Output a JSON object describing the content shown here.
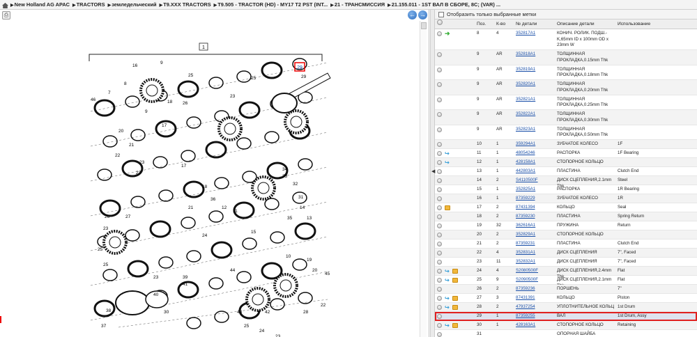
{
  "breadcrumb": {
    "items": [
      "New Holland AG APAC",
      "TRACTORS",
      "земледельческий",
      "T9.XXX TRACTORS",
      "T9.505 - TRACTOR (HD) - MY17 T2 PST (INT...",
      "21 - ТРАНСМИССИЯ",
      "21.155.011 - 1ST ВАЛ В СБОРЕ, 8C; (VAR) ..."
    ]
  },
  "filter": {
    "label": "Отобразить только выбранные метки"
  },
  "table": {
    "headers": {
      "pos": "Поз.",
      "qty": "К-во",
      "part": "№ детали",
      "desc": "Описание детали",
      "use": "Использование"
    },
    "rows": [
      {
        "pos": "8",
        "qty": "4",
        "part": "352817A1",
        "desc": "КОНИЧ. РОЛИК. ПОДШ.- K,65mm ID x 100mm OD x 23mm W",
        "use": "",
        "icons": [
          "green"
        ]
      },
      {
        "pos": "9",
        "qty": "AR",
        "part": "352818A1",
        "desc": "ТОЛЩИННАЯ ПРОКЛАДКА,0.15mm Thk",
        "use": "",
        "icons": []
      },
      {
        "pos": "9",
        "qty": "AR",
        "part": "352819A1",
        "desc": "ТОЛЩИННАЯ ПРОКЛАДКА,0.18mm Thk",
        "use": "",
        "icons": []
      },
      {
        "pos": "9",
        "qty": "AR",
        "part": "352820A1",
        "desc": "ТОЛЩИННАЯ ПРОКЛАДКА,0.20mm Thk",
        "use": "",
        "icons": []
      },
      {
        "pos": "9",
        "qty": "AR",
        "part": "352821A1",
        "desc": "ТОЛЩИННАЯ ПРОКЛАДКА,0.25mm Thk",
        "use": "",
        "icons": []
      },
      {
        "pos": "9",
        "qty": "AR",
        "part": "352822A1",
        "desc": "ТОЛЩИННАЯ ПРОКЛАДКА,0.30mm Thk",
        "use": "",
        "icons": []
      },
      {
        "pos": "9",
        "qty": "AR",
        "part": "352823A1",
        "desc": "ТОЛЩИННАЯ ПРОКЛАДКА,0.50mm Thk",
        "use": "",
        "icons": []
      },
      {
        "pos": "10",
        "qty": "1",
        "part": "359294A1",
        "desc": "ЗУБЧАТОЕ КОЛЕСО",
        "use": "1F",
        "icons": []
      },
      {
        "pos": "11",
        "qty": "1",
        "part": "48054246",
        "desc": "РАСПОРКА",
        "use": "1F Bearing",
        "icons": [
          "link"
        ]
      },
      {
        "pos": "12",
        "qty": "1",
        "part": "428158A1",
        "desc": "СТОПОРНОЕ КОЛЬЦО",
        "use": "",
        "icons": [
          "link"
        ]
      },
      {
        "pos": "13",
        "qty": "1",
        "part": "442803A1",
        "desc": "ПЛАСТИНА",
        "use": "Clutch End",
        "icons": []
      },
      {
        "pos": "14",
        "qty": "2",
        "part": "S4110500F",
        "desc": "ДИСК СЦЕПЛЕНИЯ,2.1mm Thk",
        "use": "Steel",
        "icons": []
      },
      {
        "pos": "15",
        "qty": "1",
        "part": "352825A1",
        "desc": "РАСПОРКА",
        "use": "1R Bearing",
        "icons": []
      },
      {
        "pos": "16",
        "qty": "1",
        "part": "87359229",
        "desc": "ЗУБЧАТОЕ КОЛЕСО",
        "use": "1R",
        "icons": []
      },
      {
        "pos": "17",
        "qty": "2",
        "part": "87431394",
        "desc": "КОЛЬЦО",
        "use": "Seal",
        "icons": [
          "box"
        ]
      },
      {
        "pos": "18",
        "qty": "2",
        "part": "87359230",
        "desc": "ПЛАСТИНА",
        "use": "Spring Return",
        "icons": []
      },
      {
        "pos": "19",
        "qty": "32",
        "part": "362616A1",
        "desc": "ПРУЖИНА",
        "use": "Return",
        "icons": []
      },
      {
        "pos": "20",
        "qty": "2",
        "part": "352829A1",
        "desc": "СТОПОРНОЕ КОЛЬЦО",
        "use": "",
        "icons": []
      },
      {
        "pos": "21",
        "qty": "2",
        "part": "87359231",
        "desc": "ПЛАСТИНА",
        "use": "Clutch End",
        "icons": []
      },
      {
        "pos": "22",
        "qty": "4",
        "part": "352831A1",
        "desc": "ДИСК СЦЕПЛЕНИЯ",
        "use": "7\", Faced",
        "icons": []
      },
      {
        "pos": "23",
        "qty": "11",
        "part": "352832A1",
        "desc": "ДИСК СЦЕПЛЕНИЯ",
        "use": "7\", Faced",
        "icons": []
      },
      {
        "pos": "24",
        "qty": "4",
        "part": "S2080500F",
        "desc": "ДИСК СЦЕПЛЕНИЯ,2.4mm Thk",
        "use": "Flat",
        "icons": [
          "link",
          "box"
        ]
      },
      {
        "pos": "25",
        "qty": "9",
        "part": "S2090500F",
        "desc": "ДИСК СЦЕПЛЕНИЯ,2.1mm Thk",
        "use": "Flat",
        "icons": [
          "link",
          "box"
        ]
      },
      {
        "pos": "26",
        "qty": "2",
        "part": "87359236",
        "desc": "ПОРШЕНЬ",
        "use": "7\"",
        "icons": []
      },
      {
        "pos": "27",
        "qty": "3",
        "part": "87431391",
        "desc": "КОЛЬЦО",
        "use": "Piston",
        "icons": [
          "link",
          "box"
        ]
      },
      {
        "pos": "28",
        "qty": "2",
        "part": "47937254",
        "desc": "УПЛОТНИТЕЛЬНОЕ КОЛЬЦ",
        "use": "1st Drum",
        "icons": [
          "link",
          "box"
        ]
      },
      {
        "pos": "29",
        "qty": "1",
        "part": "87359255",
        "desc": "ВАЛ",
        "use": "1st Drum, Assy",
        "icons": [],
        "selected": true
      },
      {
        "pos": "30",
        "qty": "1",
        "part": "428163A1",
        "desc": "СТОПОРНОЕ КОЛЬЦО",
        "use": "Retaining",
        "icons": [
          "link",
          "box"
        ]
      },
      {
        "pos": "31",
        "qty": "",
        "part": "",
        "desc": "ОПОРНАЯ ШАЙБА",
        "use": "",
        "icons": []
      }
    ]
  },
  "diagram": {
    "box_label": "1",
    "highlight_label": "29",
    "callouts": [
      "46",
      "7",
      "9",
      "8",
      "16",
      "9",
      "18",
      "17",
      "20",
      "21",
      "22",
      "23",
      "23",
      "25",
      "26",
      "26",
      "27",
      "23",
      "25",
      "25",
      "24",
      "23",
      "30",
      "40",
      "38",
      "37",
      "39",
      "41",
      "28",
      "29",
      "25",
      "23",
      "34",
      "33",
      "32",
      "31",
      "35",
      "36",
      "12",
      "11",
      "15",
      "14",
      "13",
      "10",
      "19",
      "20",
      "45",
      "44",
      "43",
      "42",
      "22",
      "23",
      "24",
      "25",
      "17",
      "18",
      "21"
    ]
  }
}
